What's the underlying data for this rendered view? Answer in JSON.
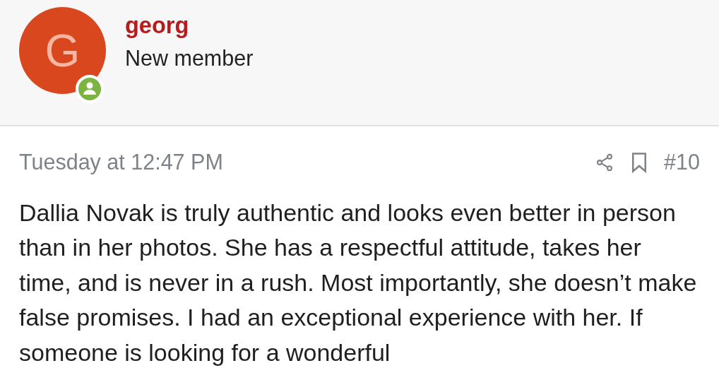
{
  "author": {
    "initial": "G",
    "name": "georg",
    "role": "New member",
    "online": true
  },
  "post": {
    "date": "Tuesday at 12:47 PM",
    "number": "#10",
    "body": "Dallia Novak is truly authentic and looks even better in person than in her photos. She has a respectful attitude, takes her time, and is never in a rush. Most importantly, she doesn’t make false promises. I had an exceptional experience with her. If someone is looking for a wonderful"
  }
}
